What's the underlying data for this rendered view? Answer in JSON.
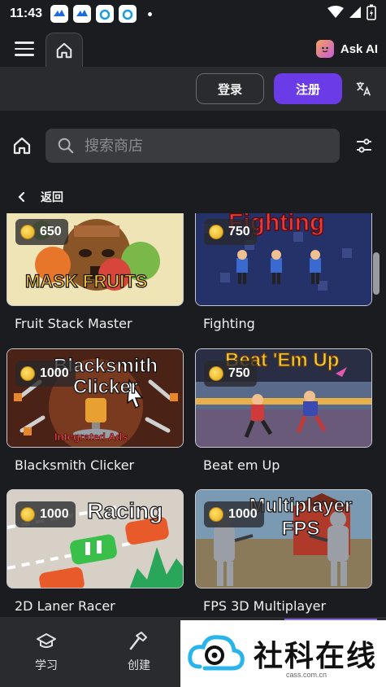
{
  "status": {
    "time": "11:43"
  },
  "header": {
    "ask_ai": "Ask AI"
  },
  "auth": {
    "login": "登录",
    "register": "注册"
  },
  "search": {
    "placeholder": "搜索商店"
  },
  "back": {
    "label": "返回"
  },
  "games": [
    {
      "title": "Fruit Stack Master",
      "price": "650",
      "art_text": "MASK FRUITS"
    },
    {
      "title": "Fighting",
      "price": "750",
      "art_text": "Fighting"
    },
    {
      "title": "Blacksmith Clicker",
      "price": "1000",
      "art_text": "Blacksmith Clicker",
      "badge": "Integrated Ads"
    },
    {
      "title": "Beat em Up",
      "price": "750",
      "art_text": "Beat 'Em Up"
    },
    {
      "title": "2D Laner Racer",
      "price": "1000",
      "art_text": "Racing"
    },
    {
      "title": "FPS 3D Multiplayer",
      "price": "1000",
      "art_text": "Multiplayer FPS"
    }
  ],
  "bottom_nav": {
    "learn": "学习",
    "create": "创建"
  },
  "watermark": {
    "text": "社科在线",
    "url": "cass.com.cn"
  },
  "colors": {
    "accent": "#6a3be6",
    "background": "#1b1c1f",
    "panel": "#2a2b2f"
  }
}
